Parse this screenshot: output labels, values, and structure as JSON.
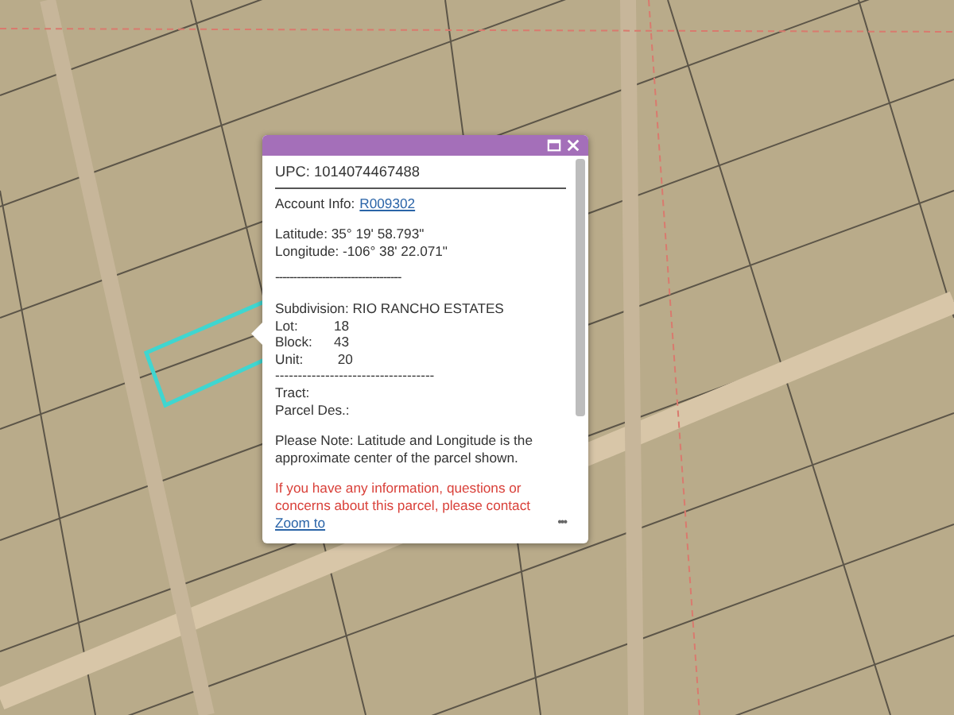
{
  "map": {
    "highlighted_parcel": true
  },
  "popup": {
    "upc": "UPC: 1014074467488",
    "account_label": "Account Info:",
    "account_link": "R009302",
    "latitude": "Latitude: 35° 19' 58.793\"",
    "longitude": "Longitude: -106° 38' 22.071\"",
    "separator_1": "-----------------------------------",
    "subdivision": "Subdivision: RIO RANCHO ESTATES",
    "fields": [
      {
        "label": "Lot:",
        "value": "18"
      },
      {
        "label": "Block:",
        "value": "43"
      },
      {
        "label": "Unit:",
        "value": " 20"
      }
    ],
    "separator_2": "-----------------------------------",
    "extra_fields": [
      "Tract:",
      "Parcel Des.:"
    ],
    "note": "Please Note: Latitude and Longitude is the approximate center of the parcel shown.",
    "warning": "If you have any information, questions or concerns about this parcel, please contact",
    "zoom_link": "Zoom to",
    "more": "•••"
  }
}
